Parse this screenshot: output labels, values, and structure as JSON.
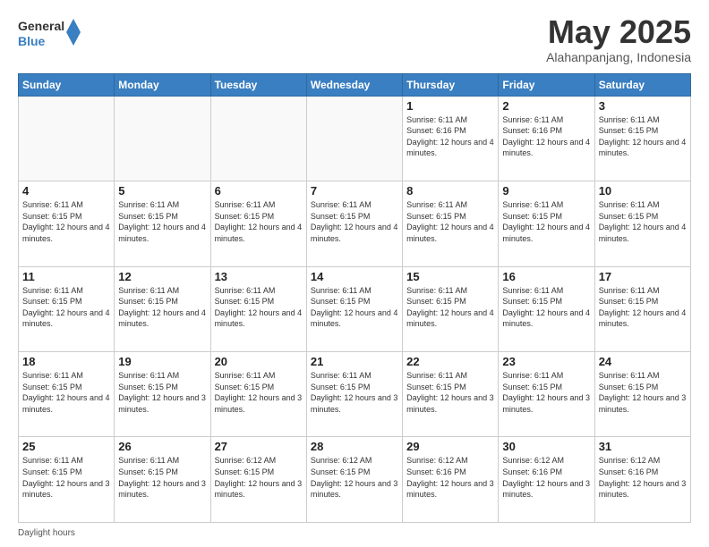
{
  "header": {
    "logo_general": "General",
    "logo_blue": "Blue",
    "month_title": "May 2025",
    "location": "Alahanpanjang, Indonesia"
  },
  "days_of_week": [
    "Sunday",
    "Monday",
    "Tuesday",
    "Wednesday",
    "Thursday",
    "Friday",
    "Saturday"
  ],
  "weeks": [
    [
      {
        "day": "",
        "info": ""
      },
      {
        "day": "",
        "info": ""
      },
      {
        "day": "",
        "info": ""
      },
      {
        "day": "",
        "info": ""
      },
      {
        "day": "1",
        "info": "Sunrise: 6:11 AM\nSunset: 6:16 PM\nDaylight: 12 hours\nand 4 minutes."
      },
      {
        "day": "2",
        "info": "Sunrise: 6:11 AM\nSunset: 6:16 PM\nDaylight: 12 hours\nand 4 minutes."
      },
      {
        "day": "3",
        "info": "Sunrise: 6:11 AM\nSunset: 6:15 PM\nDaylight: 12 hours\nand 4 minutes."
      }
    ],
    [
      {
        "day": "4",
        "info": "Sunrise: 6:11 AM\nSunset: 6:15 PM\nDaylight: 12 hours\nand 4 minutes."
      },
      {
        "day": "5",
        "info": "Sunrise: 6:11 AM\nSunset: 6:15 PM\nDaylight: 12 hours\nand 4 minutes."
      },
      {
        "day": "6",
        "info": "Sunrise: 6:11 AM\nSunset: 6:15 PM\nDaylight: 12 hours\nand 4 minutes."
      },
      {
        "day": "7",
        "info": "Sunrise: 6:11 AM\nSunset: 6:15 PM\nDaylight: 12 hours\nand 4 minutes."
      },
      {
        "day": "8",
        "info": "Sunrise: 6:11 AM\nSunset: 6:15 PM\nDaylight: 12 hours\nand 4 minutes."
      },
      {
        "day": "9",
        "info": "Sunrise: 6:11 AM\nSunset: 6:15 PM\nDaylight: 12 hours\nand 4 minutes."
      },
      {
        "day": "10",
        "info": "Sunrise: 6:11 AM\nSunset: 6:15 PM\nDaylight: 12 hours\nand 4 minutes."
      }
    ],
    [
      {
        "day": "11",
        "info": "Sunrise: 6:11 AM\nSunset: 6:15 PM\nDaylight: 12 hours\nand 4 minutes."
      },
      {
        "day": "12",
        "info": "Sunrise: 6:11 AM\nSunset: 6:15 PM\nDaylight: 12 hours\nand 4 minutes."
      },
      {
        "day": "13",
        "info": "Sunrise: 6:11 AM\nSunset: 6:15 PM\nDaylight: 12 hours\nand 4 minutes."
      },
      {
        "day": "14",
        "info": "Sunrise: 6:11 AM\nSunset: 6:15 PM\nDaylight: 12 hours\nand 4 minutes."
      },
      {
        "day": "15",
        "info": "Sunrise: 6:11 AM\nSunset: 6:15 PM\nDaylight: 12 hours\nand 4 minutes."
      },
      {
        "day": "16",
        "info": "Sunrise: 6:11 AM\nSunset: 6:15 PM\nDaylight: 12 hours\nand 4 minutes."
      },
      {
        "day": "17",
        "info": "Sunrise: 6:11 AM\nSunset: 6:15 PM\nDaylight: 12 hours\nand 4 minutes."
      }
    ],
    [
      {
        "day": "18",
        "info": "Sunrise: 6:11 AM\nSunset: 6:15 PM\nDaylight: 12 hours\nand 4 minutes."
      },
      {
        "day": "19",
        "info": "Sunrise: 6:11 AM\nSunset: 6:15 PM\nDaylight: 12 hours\nand 3 minutes."
      },
      {
        "day": "20",
        "info": "Sunrise: 6:11 AM\nSunset: 6:15 PM\nDaylight: 12 hours\nand 3 minutes."
      },
      {
        "day": "21",
        "info": "Sunrise: 6:11 AM\nSunset: 6:15 PM\nDaylight: 12 hours\nand 3 minutes."
      },
      {
        "day": "22",
        "info": "Sunrise: 6:11 AM\nSunset: 6:15 PM\nDaylight: 12 hours\nand 3 minutes."
      },
      {
        "day": "23",
        "info": "Sunrise: 6:11 AM\nSunset: 6:15 PM\nDaylight: 12 hours\nand 3 minutes."
      },
      {
        "day": "24",
        "info": "Sunrise: 6:11 AM\nSunset: 6:15 PM\nDaylight: 12 hours\nand 3 minutes."
      }
    ],
    [
      {
        "day": "25",
        "info": "Sunrise: 6:11 AM\nSunset: 6:15 PM\nDaylight: 12 hours\nand 3 minutes."
      },
      {
        "day": "26",
        "info": "Sunrise: 6:11 AM\nSunset: 6:15 PM\nDaylight: 12 hours\nand 3 minutes."
      },
      {
        "day": "27",
        "info": "Sunrise: 6:12 AM\nSunset: 6:15 PM\nDaylight: 12 hours\nand 3 minutes."
      },
      {
        "day": "28",
        "info": "Sunrise: 6:12 AM\nSunset: 6:15 PM\nDaylight: 12 hours\nand 3 minutes."
      },
      {
        "day": "29",
        "info": "Sunrise: 6:12 AM\nSunset: 6:16 PM\nDaylight: 12 hours\nand 3 minutes."
      },
      {
        "day": "30",
        "info": "Sunrise: 6:12 AM\nSunset: 6:16 PM\nDaylight: 12 hours\nand 3 minutes."
      },
      {
        "day": "31",
        "info": "Sunrise: 6:12 AM\nSunset: 6:16 PM\nDaylight: 12 hours\nand 3 minutes."
      }
    ]
  ],
  "footer": {
    "daylight_label": "Daylight hours"
  }
}
